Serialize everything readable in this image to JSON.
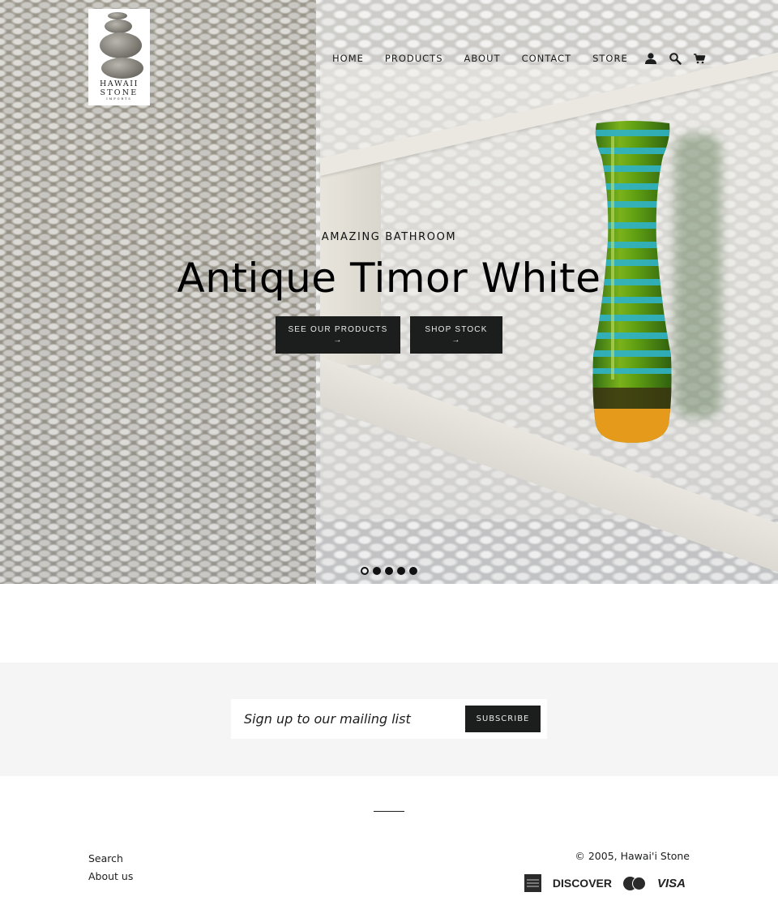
{
  "brand": {
    "logo_line1": "HAWAII",
    "logo_line2": "STONE",
    "logo_line3": "IMPORTS"
  },
  "nav": {
    "items": [
      {
        "label": "HOME"
      },
      {
        "label": "PRODUCTS"
      },
      {
        "label": "ABOUT"
      },
      {
        "label": "CONTACT"
      },
      {
        "label": "STORE"
      }
    ],
    "icons": [
      "account-icon",
      "search-icon",
      "cart-icon"
    ]
  },
  "hero": {
    "subtitle": "AMAZING BATHROOM",
    "title": "Antique Timor White",
    "buttons": [
      {
        "label": "SEE OUR PRODUCTS",
        "arrow": "→"
      },
      {
        "label": "SHOP STOCK",
        "arrow": "→"
      }
    ],
    "slides": {
      "count": 5,
      "active_index": 0
    }
  },
  "newsletter": {
    "placeholder": "Sign up to our mailing list",
    "value": "",
    "button_label": "SUBSCRIBE"
  },
  "footer": {
    "links": [
      {
        "label": "Search"
      },
      {
        "label": "About us"
      }
    ],
    "copyright": "© 2005, Hawai'i Stone",
    "payment_methods": [
      "American Express",
      "DISCOVER",
      "MasterCard",
      "VISA"
    ]
  }
}
